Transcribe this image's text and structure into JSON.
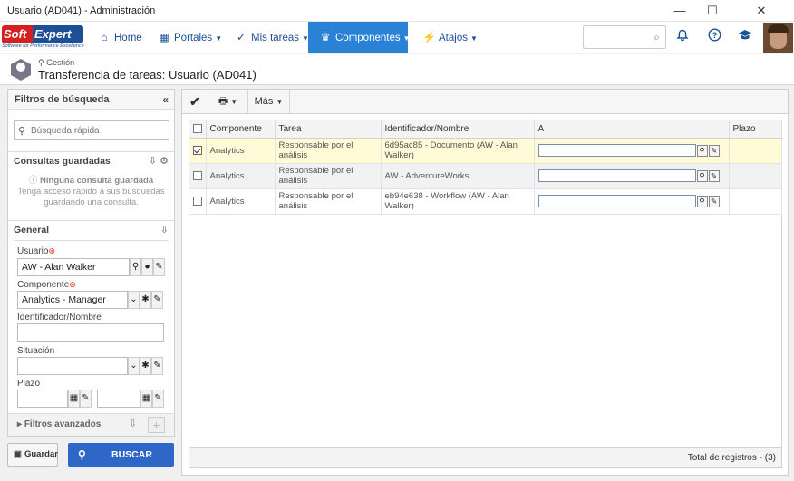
{
  "window": {
    "title": "Usuario (AD041) - Administración",
    "minimize": "—",
    "maximize": "☐",
    "close": "✕"
  },
  "logo": {
    "soft": "Soft",
    "expert": "Expert",
    "tagline": "Software for Performance Excellence"
  },
  "nav": {
    "items": [
      {
        "label": "Home",
        "icon": "home-icon",
        "glyph": "⌂",
        "caret": false
      },
      {
        "label": "Portales",
        "icon": "grid-icon",
        "glyph": "▦",
        "caret": true
      },
      {
        "label": "Mis tareas",
        "icon": "check-icon",
        "glyph": "✓",
        "caret": true
      },
      {
        "label": "Componentes",
        "icon": "trophy-icon",
        "glyph": "♛",
        "caret": true,
        "active": true
      },
      {
        "label": "Atajos",
        "icon": "bolt-icon",
        "glyph": "⚡",
        "caret": true
      }
    ],
    "search_glyph": "⌕",
    "icons": {
      "bell": "🔔",
      "help": "?",
      "grad": "🎓"
    },
    "active_color": "#2a82d6"
  },
  "header": {
    "breadcrumb": "Gestión",
    "title": "Transferencia de tareas: Usuario (AD041)"
  },
  "filters": {
    "title": "Filtros de búsqueda",
    "collapse": "«",
    "quick_search_placeholder": "Búsqueda rápida",
    "saved_title": "Consultas guardadas",
    "no_saved": "Ninguna consulta guardada",
    "no_saved_hint_1": "Tenga acceso rápido a sus búsquedas",
    "no_saved_hint_2": "guardando una consulta.",
    "general_title": "General",
    "usuario_label": "Usuario",
    "usuario_value": "AW - Alan Walker",
    "componente_label": "Componente",
    "componente_value": "Analytics - Manager",
    "identificador_label": "Identificador/Nombre",
    "identificador_value": "",
    "situacion_label": "Situación",
    "situacion_value": "",
    "plazo_label": "Plazo",
    "advanced_label": "Filtros avanzados",
    "required_mark": "⊛"
  },
  "actions": {
    "save_label": "Guardar",
    "search_label": "BUSCAR"
  },
  "toolbar": {
    "more_label": "Más"
  },
  "grid": {
    "columns": [
      "Componente",
      "Tarea",
      "Identificador/Nombre",
      "A",
      "Plazo"
    ],
    "rows": [
      {
        "checked": true,
        "componente": "Analytics",
        "tarea": "Responsable por el análisis",
        "id": "6d95ac85 - Documento (AW - Alan Walker)",
        "a": "",
        "plazo": ""
      },
      {
        "checked": false,
        "componente": "Analytics",
        "tarea": "Responsable por el análisis",
        "id": "AW - AdventureWorks",
        "a": "",
        "plazo": ""
      },
      {
        "checked": false,
        "componente": "Analytics",
        "tarea": "Responsable por el análisis",
        "id": "eb94e638 - Workflow (AW - Alan Walker)",
        "a": "",
        "plazo": ""
      }
    ],
    "total_label": "Total de registros",
    "total_value": "- (3)"
  }
}
